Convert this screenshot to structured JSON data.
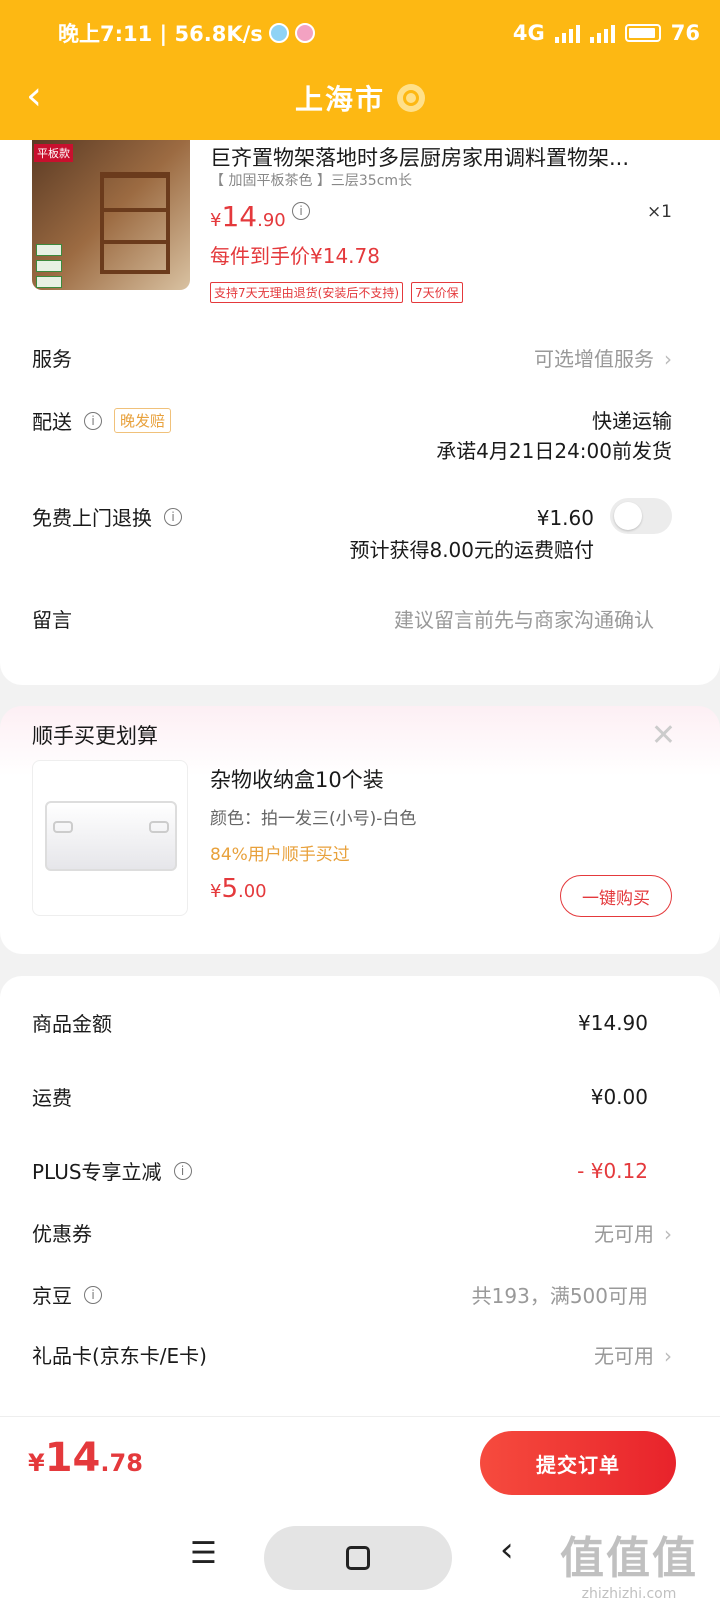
{
  "status_bar": {
    "time_speed": "晚上7:11 | 56.8K/s",
    "network": "4G",
    "battery": "76"
  },
  "header": {
    "back_icon": "chevron-left-icon",
    "title": "上海市",
    "location_icon": "location-pin-icon"
  },
  "product": {
    "title": "巨齐置物架落地时多层厨房家用调料置物架...",
    "image_tag": "平板款",
    "spec": "【 加固平板茶色 】三层35cm长",
    "price_symbol": "¥",
    "price_int": "14",
    "price_dec": ".90",
    "quantity": "×1",
    "arrive_price": "每件到手价¥14.78",
    "badges": [
      "支持7天无理由退货(安装后不支持)",
      "7天价保"
    ]
  },
  "rows": {
    "service_label": "服务",
    "service_value": "可选增值服务",
    "delivery_label": "配送",
    "delivery_badge": "晚发赔",
    "delivery_method": "快递运输",
    "delivery_promise": "承诺4月21日24:00前发货",
    "return_label": "免费上门退换",
    "return_price": "¥1.60",
    "return_note": "预计获得8.00元的运费赔付",
    "message_label": "留言",
    "message_placeholder": "建议留言前先与商家沟通确认"
  },
  "addon": {
    "title": "顺手买更划算",
    "name": "杂物收纳盒10个装",
    "spec": "颜色：拍一发三(小号)-白色",
    "rate": "84%用户顺手买过",
    "price_symbol": "¥",
    "price_int": "5",
    "price_dec": ".00",
    "buy_label": "一键购买"
  },
  "summary": {
    "goods_label": "商品金额",
    "goods_value": "¥14.90",
    "shipping_label": "运费",
    "shipping_value": "¥0.00",
    "plus_label": "PLUS专享立减",
    "plus_value": "- ¥0.12",
    "coupon_label": "优惠券",
    "coupon_value": "无可用",
    "beans_label": "京豆",
    "beans_value": "共193，满500可用",
    "giftcard_label": "礼品卡(京东卡/E卡)",
    "giftcard_value": "无可用"
  },
  "bottom": {
    "total_symbol": "¥",
    "total_int": "14",
    "total_dec": ".78",
    "submit_label": "提交订单"
  },
  "watermark": {
    "mark": "值值值",
    "url": "zhizhizhi.com"
  },
  "colors": {
    "header_bg": "#fdb813",
    "accent_red": "#e4393c",
    "accent_orange": "#e8a13c"
  }
}
